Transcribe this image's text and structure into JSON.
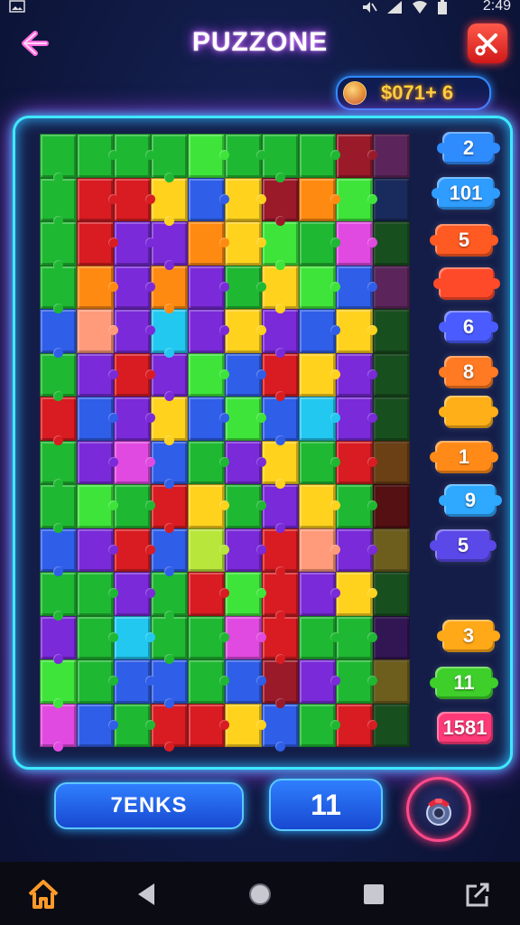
{
  "status_bar": {
    "time": "2:49",
    "icons": [
      "image-icon",
      "mute-icon",
      "signal-icon",
      "wifi-icon",
      "battery-icon"
    ]
  },
  "header": {
    "back_icon": "back-arrow-icon",
    "title": "PUZZONE",
    "tools_icon": "wrench-icon"
  },
  "coins": {
    "icon": "coin-icon",
    "text": "$071+ 6"
  },
  "colors": {
    "accent_cyan": "#3fe8ff",
    "accent_purple": "#b040ff",
    "palette": {
      "G": "#1fb832",
      "g": "#3ee43a",
      "R": "#d81c22",
      "Y": "#ffd21e",
      "O": "#ff8a12",
      "P": "#7a2ad8",
      "B": "#2f5ee8",
      "C": "#22c8f0",
      "M": "#e04ae0",
      "S": "#ff9a7a",
      "D": "#9a1a2a",
      "L": "#b8e63a"
    }
  },
  "board": {
    "cols": 10,
    "rows": [
      "GGGGgGGGDM",
      "GRRYBYDOgB",
      "GRPPOYgGMG",
      "GOPOPGYgBM",
      "BSPCPYPBYG",
      "GPRPgBRYPG",
      "RBPYBgBCPG",
      "GPMBGPYGRO",
      "GgGRYGPYGR",
      "BPRBLPRSPY",
      "GGPGRgRPYG",
      "PGCGGMRGGP",
      "gGBBGBDPGY",
      "MBGRRYBGRG"
    ],
    "dim_cols": [
      9
    ]
  },
  "side_pieces": [
    {
      "label": "2",
      "color": "#2f8cff"
    },
    {
      "label": "101",
      "color": "#2f9cff"
    },
    {
      "label": "5",
      "color": "#ff5a22"
    },
    {
      "label": "",
      "color": "#ff4a2a"
    },
    {
      "label": "6",
      "color": "#4a5cff"
    },
    {
      "label": "8",
      "color": "#ff7a22"
    },
    {
      "label": "",
      "color": "#ffb018"
    },
    {
      "label": "1",
      "color": "#ff8a18"
    },
    {
      "label": "9",
      "color": "#2fa8ff"
    },
    {
      "label": "5",
      "color": "#5a48e8"
    },
    {
      "label": "3",
      "color": "#ffa818"
    },
    {
      "label": "11",
      "color": "#3ecf2a"
    },
    {
      "label": "1581",
      "color": "#ff3a78"
    }
  ],
  "bottom": {
    "tokens_label": "7ENKS",
    "count_label": "11",
    "shop_icon": "gadget-icon"
  },
  "nav": {
    "items": [
      "home-icon",
      "back-triangle-icon",
      "home-circle-icon",
      "recents-square-icon",
      "share-icon"
    ]
  }
}
